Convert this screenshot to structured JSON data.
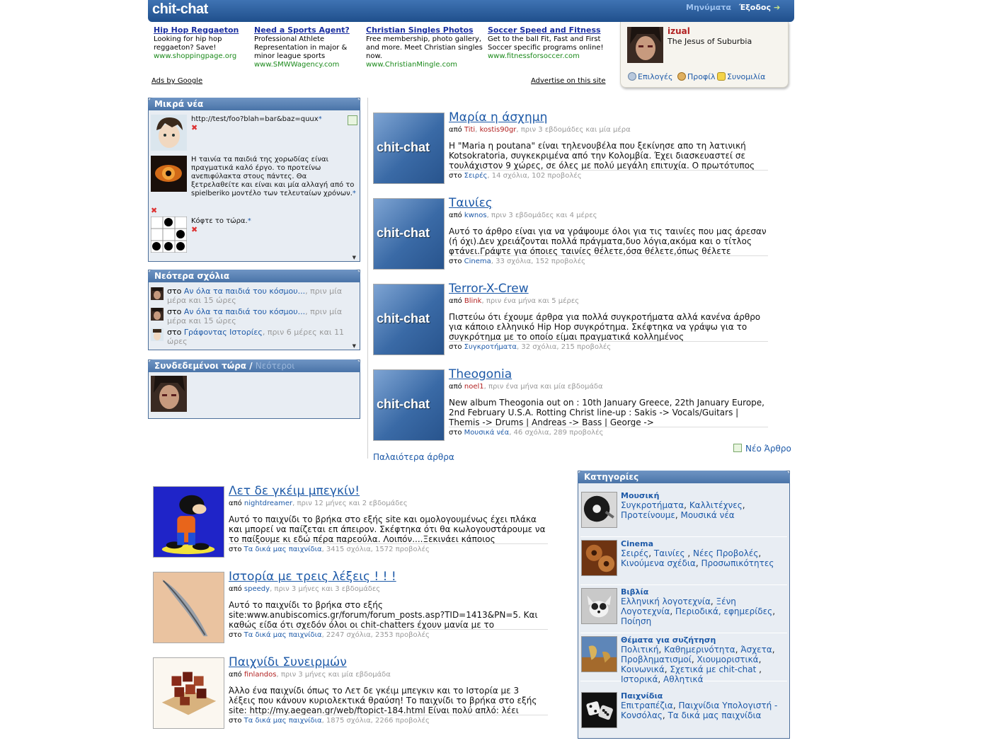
{
  "header": {
    "logo": "chit-chat",
    "messages": "Μηνύματα",
    "exit": "Έξοδος"
  },
  "ads": [
    {
      "title": "Hip Hop Reggaeton",
      "text": "Looking for hip hop reggaeton? Save!",
      "url": "www.shoppingpage.org"
    },
    {
      "title": "Need a Sports Agent?",
      "text": "Professional Athlete Representation in major & minor league sports",
      "url": "www.SMWWagency.com"
    },
    {
      "title": "Christian Singles Photos",
      "text": "Free membership, photo gallery, and more. Meet Christian singles now.",
      "url": "www.ChristianMingle.com"
    },
    {
      "title": "Soccer Speed and Fitness",
      "text": "Get to the ball Fit, Fast and First Soccer specific programs online!",
      "url": "www.fitnessforsoccer.com"
    }
  ],
  "ads_footer": {
    "google": "Ads by Google",
    "advertise": "Advertise on this site"
  },
  "user": {
    "name": "izual",
    "tagline": "The Jesus of Suburbia",
    "options": "Επιλογές",
    "profile": "Προφίλ",
    "chat": "Συνομιλία"
  },
  "news_panel": {
    "title": "Μικρά νέα",
    "items": [
      {
        "text": "http://test/foo?blah=bar&baz=quux",
        "star": "*"
      },
      {
        "text": "Η ταινία τα παιδιά της χορωδίας είναι πραγματικά καλό έργο. το προτείνω ανεπιφύλακτα στους πάντες. Θα ξετρελαθείτε και είναι και μία αλλαγή από το spielberiko μοντέλο των τελευταίων χρόνων.",
        "star": "*"
      },
      {
        "text": "Κόφτε το τώρα.",
        "star": "*"
      }
    ]
  },
  "comments_panel": {
    "title": "Νεότερα σχόλια",
    "items": [
      {
        "prefix": "στο",
        "link": "Αν όλα τα παιδιά του κόσμου...",
        "time": ", πριν μία μέρα και 15 ώρες"
      },
      {
        "prefix": "στο",
        "link": "Αν όλα τα παιδιά του κόσμου...",
        "time": ", πριν μία μέρα και 15 ώρες"
      },
      {
        "prefix": "στο",
        "link": "Γράφοντας Ιστορίες",
        "time": ", πριν 6 μέρες και 11 ώρες"
      }
    ]
  },
  "online_panel": {
    "title": "Συνδεδεμένοι τώρα",
    "sep": "/",
    "newest": "Νεότεροι"
  },
  "articles": [
    {
      "thumb": "chit-chat",
      "title": "Μαρία η άσχημη",
      "by": "από",
      "author": "Titi",
      "author2": "kostis90gr",
      "time": ", πριν 3 εβδομάδες και μία μέρα",
      "body": "Η \"Maria η poutana\" είναι τηλενουβέλα που ξεκίνησε απο τη λατινική Kotsokratoria, συγκεκριμένα από την Κολομβία. Έχει διασκευαστεί σε τουλάχιστον 9 χώρες, σε όλες με πολύ μεγάλη επιτυχία. Ο πρωτότυπος",
      "in": "στο",
      "cat": "Σειρές",
      "stats": ", 14 σχόλια, 102 προβολές"
    },
    {
      "thumb": "chit-chat",
      "title": "Ταινίες",
      "by": "από",
      "author": "kwnos",
      "author2": "",
      "time": ", πριν 3 εβδομάδες και 4 μέρες",
      "body": "Αυτό το άρθρο είναι για να γράψουμε όλοι για τις ταινίες που μας άρεσαν (ή όχι).Δεν χρειάζονται πολλά πράγματα,δυο λόγια,ακόμα και ο τίτλος φτάνει.Γράψτε για όποιες ταινίες θέλετε,όσα θέλετε,όπως θέλετε",
      "in": "στο",
      "cat": "Cinema",
      "stats": ", 33 σχόλια, 152 προβολές"
    },
    {
      "thumb": "chit-chat",
      "title": "Terror-X-Crew",
      "by": "από",
      "author": "Blink",
      "author2": "",
      "time": ", πριν ένα μήνα και 5 μέρες",
      "body": "Πιστεύω ότι έχουμε άρθρα για πολλά συγκροτήματα αλλά κανένα άρθρο για κάποιο ελληνικό Hip Hop συγκρότημα. Σκέφτηκα να γράψω για το συγκρότημα με το οποίο είμαι πραγματικά κολλημένος",
      "in": "στο",
      "cat": "Συγκροτήματα",
      "stats": ", 32 σχόλια, 215 προβολές"
    },
    {
      "thumb": "chit-chat",
      "title": "Theogonia",
      "by": "από",
      "author": "noel1",
      "author2": "",
      "time": ", πριν ένα μήνα και μία εβδομάδα",
      "body": "New album Theogonia out on : 10th January Greece, 22th January Europe, 2nd February U.S.A. Rotting Christ line-up : Sakis -> Vocals/Guitars | Themis -> Drums | Andreas -> Bass | George ->",
      "in": "στο",
      "cat": "Μουσικά νέα",
      "stats": ", 46 σχόλια, 289 προβολές"
    }
  ],
  "new_article": "Νέο Άρθρο",
  "older_articles": "Παλαιότερα άρθρα",
  "games": [
    {
      "title": "Λετ δε γκέιμ μπεγκίν!",
      "by": "από",
      "author": "nightdreamer",
      "time": ", πριν 12 μήνες και 2 εβδομάδες",
      "body": "Αυτό το παιχνίδι το βρήκα στο εξής site και ομολογουμένως έχει πλάκα και μπορεί να παίζεται επ άπειρον. Σκέφτηκα ότι θα κωλογουστάρουμε να το παίξουμε κι εδώ πέρα παρεούλα. Λοιπόν....Ξεκινάει κάποιος",
      "in": "στο",
      "cat": "Τα δικά μας παιχνίδια",
      "stats": ", 3415 σχόλια, 1572 προβολές"
    },
    {
      "title": "Ιστορία με τρεις λέξεις ! ! !",
      "by": "από",
      "author": "speedy",
      "time": ", πριν 3 μήνες και 3 εβδομάδες",
      "body": "Αυτό το παιχνίδι το βρήκα στο εξής site:www.anubiscomics.gr/forum/forum_posts.asp?TID=1413&PN=5. Και καθώς είδα ότι σχεδόν όλοι οι chit-chatters έχουν μανία με το",
      "in": "στο",
      "cat": "Τα δικά μας παιχνίδια",
      "stats": ", 2247 σχόλια, 2353 προβολές"
    },
    {
      "title": "Παιχνίδι Συνειρμών",
      "by": "από",
      "author": "finlandos",
      "time": ", πριν 3 μήνες και μία εβδομάδα",
      "body": "Άλλο ένα παιχνίδι όπως το Λετ δε γκέιμ μπεγκιν και το Ιστορία με 3 λέξεις που κάνουν κυριολεκτικά θραύση! Το παιχνίδι το βρήκα στο εξής site: http://my.aegean.gr/web/ftopict-184.html Είναι πολύ απλό: λέει",
      "in": "στο",
      "cat": "Τα δικά μας παιχνίδια",
      "stats": ", 1875 σχόλια, 2266 προβολές"
    }
  ],
  "categories": {
    "title": "Κατηγορίες",
    "items": [
      {
        "name": "Μουσική",
        "links": [
          "Συγκροτήματα",
          "Καλλιτέχνες",
          "Προτείνουμε",
          "Μουσικά νέα"
        ]
      },
      {
        "name": "Cinema",
        "links": [
          "Σειρές",
          "Ταινίες ",
          "Νέες Προβολές",
          "Κινούμενα σχέδια",
          "Προσωπικότητες"
        ]
      },
      {
        "name": "Βιβλία",
        "links": [
          "Ελληνική λογοτεχνία",
          "Ξένη Λογοτεχνία",
          "Περιοδικά, εφημερίδες",
          "Ποίηση"
        ]
      },
      {
        "name": "Θέματα για συζήτηση",
        "links": [
          "Πολιτική",
          "Καθημερινότητα",
          "Άσχετα",
          "Προβληματισμοί",
          "Χιουμοριστικά",
          "Κοινωνικά",
          "Σχετικά με chit-chat ",
          "Ιστορικά",
          "Αθλητικά"
        ]
      },
      {
        "name": "Παιχνίδια",
        "links": [
          "Επιτραπέζια",
          "Παιχνίδια Υπολογιστή - Κονσόλας",
          "Τα δικά μας παιχνίδια"
        ]
      }
    ]
  }
}
